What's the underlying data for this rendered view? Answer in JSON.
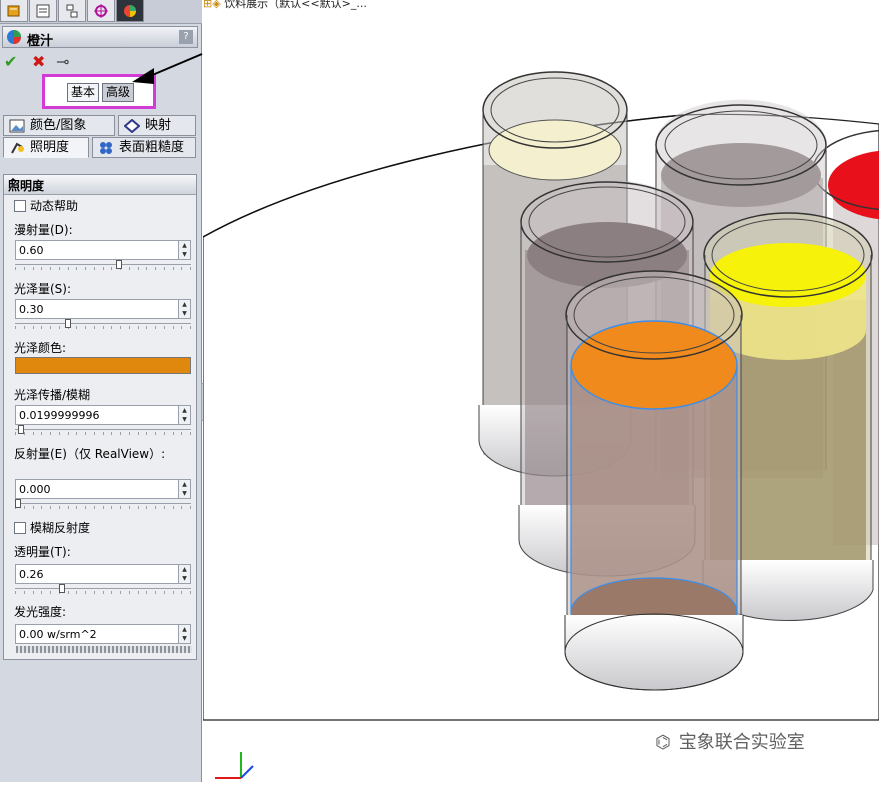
{
  "tree": {
    "label": "饮料展示（默认<<默认>_..."
  },
  "panel": {
    "title": "橙汁",
    "help": "?",
    "actions": {
      "ok": "✔",
      "cancel": "✖",
      "pin": "⊸"
    },
    "modes": {
      "basic": "基本",
      "advanced": "高级"
    },
    "tabs": {
      "color_image": "颜色/图象",
      "mapping": "映射",
      "illumination": "照明度",
      "surface_finish": "表面粗糙度"
    },
    "group": {
      "title": "照明度",
      "dynamic_help": "动态帮助",
      "diffuse_label": "漫射量(D):",
      "diffuse_value": "0.60",
      "diffuse_level": 0.6,
      "specular_label": "光泽量(S):",
      "specular_value": "0.30",
      "specular_level": 0.3,
      "specular_color_label": "光泽颜色:",
      "specular_color": "#e0870e",
      "spread_label": "光泽传播/模糊",
      "spread_value": "0.0199999996",
      "spread_level": 0.02,
      "reflect_label": "反射量(E)（仅 RealView）:",
      "reflect_value": "0.000",
      "reflect_level": 0.0,
      "blur_reflect": "模糊反射度",
      "transparency_label": "透明量(T):",
      "transparency_value": "0.26",
      "transparency_level": 0.26,
      "luminous_label": "发光强度:",
      "luminous_value": "0.00 w/srm^2"
    }
  },
  "colors": {
    "orange": "#f08a1c",
    "yellow": "#f6f20a",
    "red": "#e8101a",
    "highlight_box": "#d23bd6"
  },
  "watermark": {
    "icon": "wechat-icon",
    "text": "宝象联合实验室"
  }
}
